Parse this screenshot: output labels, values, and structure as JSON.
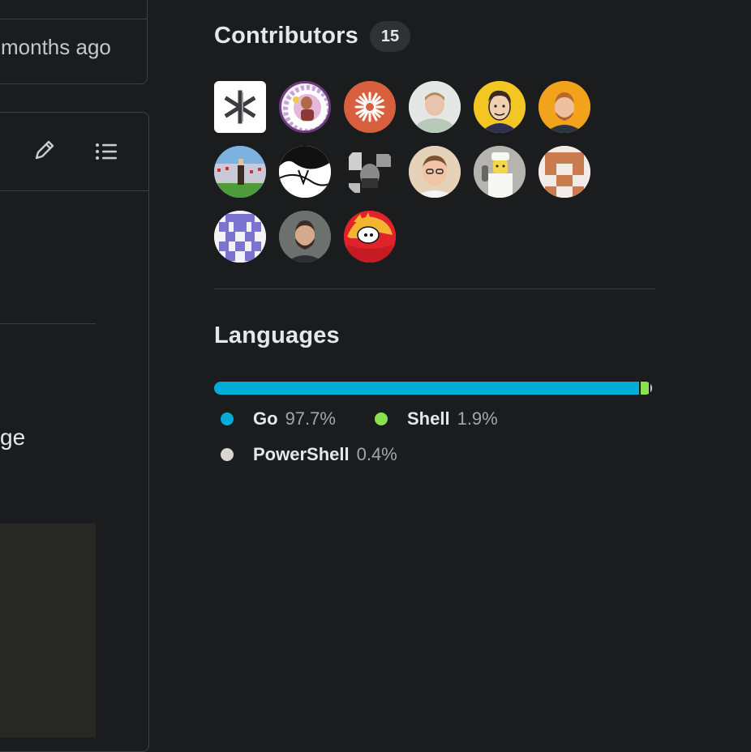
{
  "repo": {
    "last_commit_text": "months ago",
    "readme_partial_word": "ge"
  },
  "contributors": {
    "title": "Contributors",
    "count": "15",
    "avatars": [
      {
        "name": "avatar-1"
      },
      {
        "name": "avatar-2"
      },
      {
        "name": "avatar-3"
      },
      {
        "name": "avatar-4"
      },
      {
        "name": "avatar-5"
      },
      {
        "name": "avatar-6"
      },
      {
        "name": "avatar-7"
      },
      {
        "name": "avatar-8"
      },
      {
        "name": "avatar-9"
      },
      {
        "name": "avatar-10"
      },
      {
        "name": "avatar-11"
      },
      {
        "name": "avatar-12"
      },
      {
        "name": "avatar-13"
      },
      {
        "name": "avatar-14"
      },
      {
        "name": "avatar-15"
      }
    ]
  },
  "languages": {
    "title": "Languages",
    "items": [
      {
        "name": "Go",
        "percent": "97.7%",
        "value": 97.7,
        "color": "#00add8"
      },
      {
        "name": "Shell",
        "percent": "1.9%",
        "value": 1.9,
        "color": "#89e051"
      },
      {
        "name": "PowerShell",
        "percent": "0.4%",
        "value": 0.4,
        "color": "#d9d6d2"
      }
    ]
  },
  "colors": {
    "background": "#1b1c1e",
    "border": "#3d4046",
    "text": "#e6e7e8",
    "muted": "#a4a6aa"
  },
  "icons": {
    "edit": "pencil-icon",
    "outline": "list-icon"
  }
}
